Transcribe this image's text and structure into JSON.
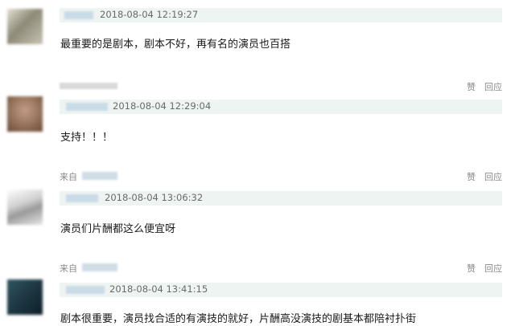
{
  "comments": [
    {
      "avatar_colors": [
        "#c7c3b3",
        "#8e8a78",
        "#e3e0d4"
      ],
      "timestamp": "2018-08-04 12:19:27",
      "text": "最重要的是剧本，剧本不好，再有名的演员也百搭"
    },
    {
      "avatar_colors": [
        "#9c7a62",
        "#6b4a3a",
        "#c59a88"
      ],
      "timestamp": "2018-08-04 12:29:04",
      "text": "支持！！！"
    },
    {
      "avatar_colors": [
        "#e6e6e6",
        "#9a9a9a",
        "#d0d0d0"
      ],
      "timestamp": "2018-08-04 13:06:32",
      "text": "演员们片酬都这么便宜呀"
    },
    {
      "avatar_colors": [
        "#1f3a45",
        "#0e1e28",
        "#2f5563"
      ],
      "timestamp": "2018-08-04 13:41:15",
      "text": "剧本很重要，演员找合适的有演技的就好，片酬高没演技的剧基本都陪衬扑街"
    }
  ],
  "actions": {
    "like_label": "赞",
    "reply_label": "回应"
  },
  "source_label": "来自"
}
